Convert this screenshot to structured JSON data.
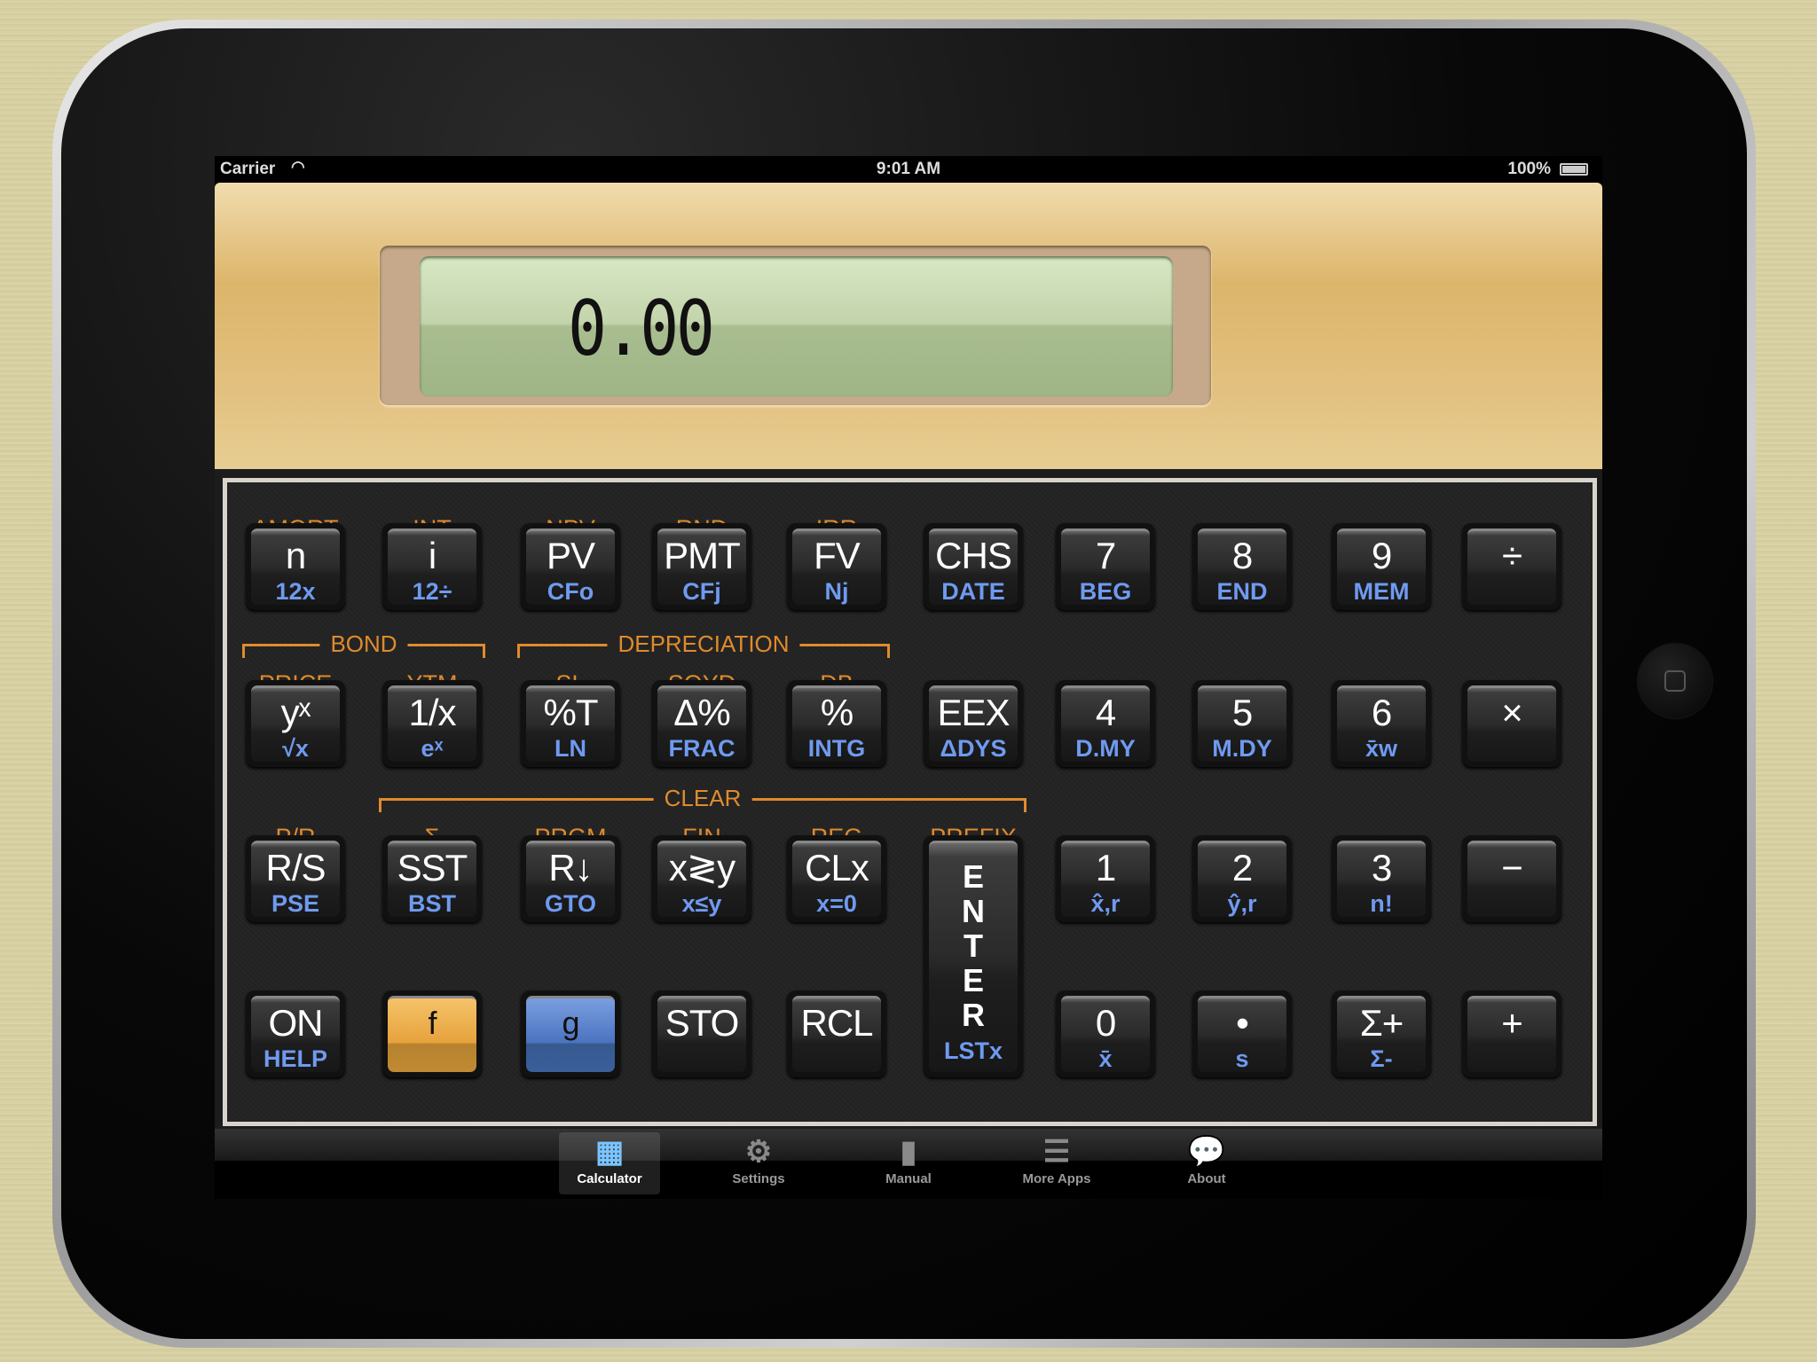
{
  "status_bar": {
    "carrier": "Carrier",
    "time": "9:01 AM",
    "battery": "100%"
  },
  "display": {
    "value": "0.00"
  },
  "colors": {
    "gold_label": "#e08b2c",
    "blue_label": "#6f9af0",
    "f_key": "#e7a23c",
    "g_key": "#4b73bf"
  },
  "gold_labels": [
    {
      "row": 0,
      "col": 0,
      "text": "AMORT"
    },
    {
      "row": 0,
      "col": 1,
      "text": "INT"
    },
    {
      "row": 0,
      "col": 2,
      "text": "NPV"
    },
    {
      "row": 0,
      "col": 3,
      "text": "RND"
    },
    {
      "row": 0,
      "col": 4,
      "text": "IRR"
    },
    {
      "row": 1,
      "col": 0,
      "text": "PRICE"
    },
    {
      "row": 1,
      "col": 1,
      "text": "YTM"
    },
    {
      "row": 1,
      "col": 2,
      "text": "SL"
    },
    {
      "row": 1,
      "col": 3,
      "text": "SOYD"
    },
    {
      "row": 1,
      "col": 4,
      "text": "DB"
    },
    {
      "row": 2,
      "col": 0,
      "text": "P/R"
    },
    {
      "row": 2,
      "col": 1,
      "text": "Σ"
    },
    {
      "row": 2,
      "col": 2,
      "text": "PRGM"
    },
    {
      "row": 2,
      "col": 3,
      "text": "FIN"
    },
    {
      "row": 2,
      "col": 4,
      "text": "REG"
    },
    {
      "row": 2,
      "col": 5,
      "text": "PREFIX"
    }
  ],
  "brackets": [
    {
      "row": 1,
      "from": 0,
      "to": 1,
      "text": "BOND"
    },
    {
      "row": 1,
      "from": 2,
      "to": 4,
      "text": "DEPRECIATION"
    },
    {
      "row": 2,
      "from": 1,
      "to": 5,
      "text": "CLEAR"
    }
  ],
  "keys": [
    {
      "row": 0,
      "col": 0,
      "main": "n",
      "blue": "12x"
    },
    {
      "row": 0,
      "col": 1,
      "main": "i",
      "blue": "12÷"
    },
    {
      "row": 0,
      "col": 2,
      "main": "PV",
      "blue": "CFo"
    },
    {
      "row": 0,
      "col": 3,
      "main": "PMT",
      "blue": "CFj"
    },
    {
      "row": 0,
      "col": 4,
      "main": "FV",
      "blue": "Nj"
    },
    {
      "row": 0,
      "col": 5,
      "main": "CHS",
      "blue": "DATE"
    },
    {
      "row": 0,
      "col": 6,
      "main": "7",
      "blue": "BEG"
    },
    {
      "row": 0,
      "col": 7,
      "main": "8",
      "blue": "END"
    },
    {
      "row": 0,
      "col": 8,
      "main": "9",
      "blue": "MEM"
    },
    {
      "row": 0,
      "col": 9,
      "main": "÷",
      "blue": ""
    },
    {
      "row": 1,
      "col": 0,
      "main": "yˣ",
      "blue": "√x"
    },
    {
      "row": 1,
      "col": 1,
      "main": "1/x",
      "blue": "eˣ"
    },
    {
      "row": 1,
      "col": 2,
      "main": "%T",
      "blue": "LN"
    },
    {
      "row": 1,
      "col": 3,
      "main": "Δ%",
      "blue": "FRAC"
    },
    {
      "row": 1,
      "col": 4,
      "main": "%",
      "blue": "INTG"
    },
    {
      "row": 1,
      "col": 5,
      "main": "EEX",
      "blue": "ΔDYS"
    },
    {
      "row": 1,
      "col": 6,
      "main": "4",
      "blue": "D.MY"
    },
    {
      "row": 1,
      "col": 7,
      "main": "5",
      "blue": "M.DY"
    },
    {
      "row": 1,
      "col": 8,
      "main": "6",
      "blue": "x̄w"
    },
    {
      "row": 1,
      "col": 9,
      "main": "×",
      "blue": ""
    },
    {
      "row": 2,
      "col": 0,
      "main": "R/S",
      "blue": "PSE"
    },
    {
      "row": 2,
      "col": 1,
      "main": "SST",
      "blue": "BST"
    },
    {
      "row": 2,
      "col": 2,
      "main": "R↓",
      "blue": "GTO"
    },
    {
      "row": 2,
      "col": 3,
      "main": "x≷y",
      "blue": "x≤y"
    },
    {
      "row": 2,
      "col": 4,
      "main": "CLx",
      "blue": "x=0"
    },
    {
      "row": 2,
      "col": 6,
      "main": "1",
      "blue": "x̂,r"
    },
    {
      "row": 2,
      "col": 7,
      "main": "2",
      "blue": "ŷ,r"
    },
    {
      "row": 2,
      "col": 8,
      "main": "3",
      "blue": "n!"
    },
    {
      "row": 2,
      "col": 9,
      "main": "−",
      "blue": ""
    },
    {
      "row": 3,
      "col": 0,
      "main": "ON",
      "blue": "HELP"
    },
    {
      "row": 3,
      "col": 1,
      "main": "f",
      "blue": "",
      "style": "f"
    },
    {
      "row": 3,
      "col": 2,
      "main": "g",
      "blue": "",
      "style": "g"
    },
    {
      "row": 3,
      "col": 3,
      "main": "STO",
      "blue": ""
    },
    {
      "row": 3,
      "col": 4,
      "main": "RCL",
      "blue": ""
    },
    {
      "row": 3,
      "col": 6,
      "main": "0",
      "blue": "x̄"
    },
    {
      "row": 3,
      "col": 7,
      "main": "•",
      "blue": "s"
    },
    {
      "row": 3,
      "col": 8,
      "main": "Σ+",
      "blue": "Σ-"
    },
    {
      "row": 3,
      "col": 9,
      "main": "+",
      "blue": ""
    }
  ],
  "enter_key": {
    "letters": [
      "E",
      "N",
      "T",
      "E",
      "R"
    ],
    "blue": "LSTx"
  },
  "tabs": [
    {
      "label": "Calculator",
      "icon": "calculator-icon",
      "active": true
    },
    {
      "label": "Settings",
      "icon": "gear-icon"
    },
    {
      "label": "Manual",
      "icon": "book-icon"
    },
    {
      "label": "More Apps",
      "icon": "cabinet-icon"
    },
    {
      "label": "About",
      "icon": "speech-bubble-icon"
    }
  ]
}
